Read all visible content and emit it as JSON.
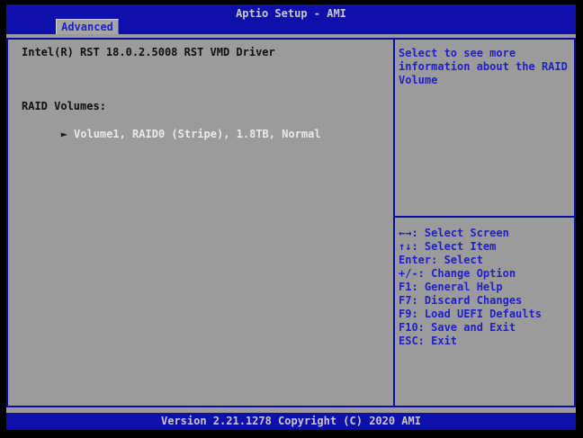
{
  "header": {
    "title": "Aptio Setup - AMI",
    "tab": "Advanced"
  },
  "main": {
    "driver_title": "Intel(R) RST 18.0.2.5008 RST VMD Driver",
    "section_label": "RAID Volumes:",
    "volume_item": {
      "arrow": "►",
      "label": "Volume1, RAID0 (Stripe), 1.8TB, Normal"
    }
  },
  "help": {
    "text": "Select to see more information about the RAID Volume"
  },
  "legend": {
    "lines": [
      "←→: Select Screen",
      "↑↓: Select Item",
      "Enter: Select",
      "+/-: Change Option",
      "F1: General Help",
      "F7: Discard Changes",
      "F9: Load UEFI Defaults",
      "F10: Save and Exit",
      "ESC: Exit"
    ]
  },
  "footer": {
    "version_text": "Version 2.21.1278 Copyright (C) 2020 AMI"
  },
  "colors": {
    "header_blue": "#0F0FAB",
    "panel_gray": "#9B9B9B",
    "border_blue": "#0C0CA2",
    "text_blue": "#2121C7",
    "text_black": "#111111",
    "selected_item_text": "#E9E9E9",
    "header_text": "#C8C8C8"
  }
}
